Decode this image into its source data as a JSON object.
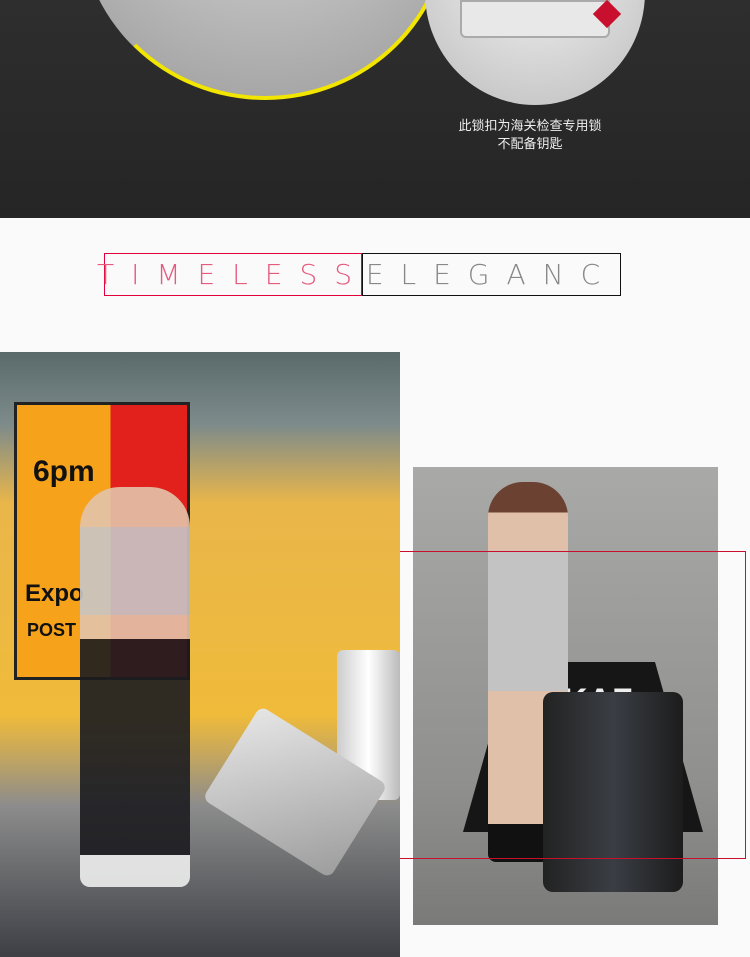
{
  "lock_section": {
    "caption_line1": "此锁扣为海关检查专用锁",
    "caption_line2": "不配备钥匙"
  },
  "title": {
    "part1": "TIMELESS",
    "part2": "ELEGANC"
  },
  "photo_left": {
    "poster_time": "6pm",
    "poster_word1": "Expo",
    "poster_word2": "POST"
  },
  "photo_right": {
    "sign_text": "KAZ"
  },
  "colors": {
    "accent": "#e2003c",
    "dark_bg": "#2a2a2a",
    "page_bg": "#fafafa"
  }
}
